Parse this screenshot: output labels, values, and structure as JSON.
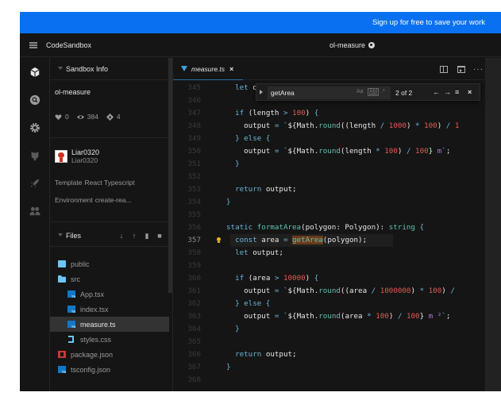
{
  "banner": {
    "cta": "Sign up for free to save your work",
    "color": "#0971f1"
  },
  "header": {
    "brand": "CodeSandbox",
    "sandbox_title": "ol-measure"
  },
  "activity_bar": [
    {
      "icon": "cube-icon",
      "active": true
    },
    {
      "icon": "search-icon",
      "active": false
    },
    {
      "icon": "gear-icon",
      "active": false
    },
    {
      "icon": "github-icon",
      "active": false
    },
    {
      "icon": "rocket-icon",
      "active": false
    },
    {
      "icon": "users-icon",
      "active": false
    }
  ],
  "sandbox_info": {
    "title": "Sandbox Info",
    "name": "ol-measure",
    "likes": "0",
    "views": "384",
    "forks": "4",
    "author": {
      "display_name": "Liar0320",
      "username": "Liar0320"
    },
    "template_label": "Template",
    "template_value": "React Typescript",
    "environment_label": "Environment",
    "environment_value": "create-rea..."
  },
  "files": {
    "title": "Files",
    "actions": [
      "download-icon",
      "upload-icon",
      "new-file-icon",
      "new-folder-icon"
    ],
    "items": [
      {
        "name": "public",
        "type": "folder",
        "depth": 0,
        "active": false
      },
      {
        "name": "src",
        "type": "folder-open",
        "depth": 0,
        "active": false
      },
      {
        "name": "App.tsx",
        "type": "ts",
        "depth": 1,
        "active": false
      },
      {
        "name": "index.tsx",
        "type": "ts",
        "depth": 1,
        "active": false
      },
      {
        "name": "measure.ts",
        "type": "ts",
        "depth": 1,
        "active": true
      },
      {
        "name": "styles.css",
        "type": "css",
        "depth": 1,
        "active": false
      },
      {
        "name": "package.json",
        "type": "npm",
        "depth": 0,
        "active": false
      },
      {
        "name": "tsconfig.json",
        "type": "ts",
        "depth": 0,
        "active": false
      }
    ]
  },
  "editor": {
    "tab": {
      "name": "measure.ts",
      "close": "×"
    },
    "find": {
      "query": "getArea",
      "match_case": "Aa",
      "whole_word": "Abl",
      "regex": ".*",
      "count": "2 of 2",
      "prev": "←",
      "next": "→",
      "in_selection": "≡",
      "close": "×"
    },
    "current_line": 357,
    "lines": [
      {
        "n": "345",
        "html": "  <span class='k'>let</span> output;"
      },
      {
        "n": "346",
        "html": ""
      },
      {
        "n": "347",
        "html": "  <span class='k'>if</span> (length <span class='o'>&gt;</span> <span class='n'>100</span>) <span class='k'>{</span>"
      },
      {
        "n": "348",
        "html": "    output <span class='o'>=</span> <span class='o'>`</span>${Math.<span class='f'>round</span>((length <span class='o'>/</span> <span class='n'>1000</span>) <span class='o'>*</span> <span class='n'>100</span>) <span class='o'>/</span> <span class='n'>1</span>"
      },
      {
        "n": "349",
        "html": "  <span class='k'>} else {</span>"
      },
      {
        "n": "350",
        "html": "    output <span class='o'>=</span> <span class='o'>`</span>${Math.<span class='f'>round</span>(length <span class='o'>*</span> <span class='n'>100</span>) <span class='o'>/</span> <span class='n'>100</span>} <span class='p'>m</span><span class='o'>`</span>;"
      },
      {
        "n": "351",
        "html": "  <span class='k'>}</span>"
      },
      {
        "n": "352",
        "html": ""
      },
      {
        "n": "353",
        "html": "  <span class='k'>return</span> output;"
      },
      {
        "n": "354",
        "html": "<span class='k'>}</span>"
      },
      {
        "n": "355",
        "html": ""
      },
      {
        "n": "356",
        "html": "<span class='k'>static</span> <span class='f'>formatArea</span>(polygon: Polygon): <span class='f'>string</span> <span class='k'>{</span>"
      },
      {
        "n": "357",
        "html": "  <span class='k'>const</span> area <span class='o'>=</span> <span class='f match'>getArea</span>(polygon);"
      },
      {
        "n": "358",
        "html": "  <span class='k'>let</span> output;"
      },
      {
        "n": "359",
        "html": ""
      },
      {
        "n": "360",
        "html": "  <span class='k'>if</span> (area <span class='o'>&gt;</span> <span class='n'>10000</span>) <span class='k'>{</span>"
      },
      {
        "n": "361",
        "html": "    output <span class='o'>=</span> <span class='o'>`</span>${Math.<span class='f'>round</span>((area <span class='o'>/</span> <span class='n'>1000000</span>) <span class='o'>*</span> <span class='n'>100</span>) <span class='o'>/</span>"
      },
      {
        "n": "362",
        "html": "  <span class='k'>} else {</span>"
      },
      {
        "n": "363",
        "html": "    output <span class='o'>=</span> <span class='o'>`</span>${Math.<span class='f'>round</span>(area <span class='o'>*</span> <span class='n'>100</span>) <span class='o'>/</span> <span class='n'>100</span>} <span class='p'>m ²</span><span class='o'>`</span>;"
      },
      {
        "n": "364",
        "html": "  <span class='k'>}</span>"
      },
      {
        "n": "365",
        "html": ""
      },
      {
        "n": "366",
        "html": "  <span class='k'>return</span> output;"
      },
      {
        "n": "367",
        "html": "<span class='k'>}</span>"
      },
      {
        "n": "368",
        "html": ""
      }
    ]
  },
  "colors": {
    "background": "#151515",
    "accent": "#0971f1",
    "keyword": "#6cb4d6",
    "function": "#5fc1b0",
    "number": "#e25a53",
    "match": "#6a3a1a"
  }
}
